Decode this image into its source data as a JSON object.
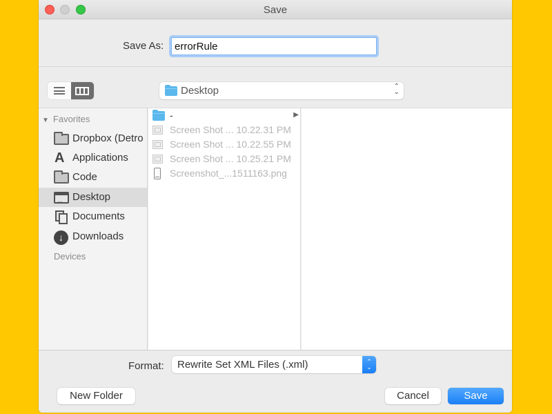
{
  "window": {
    "title": "Save",
    "background_color": "#FFC800"
  },
  "save_as": {
    "label": "Save As:",
    "value": "errorRule"
  },
  "toolbar": {
    "view_modes": [
      {
        "name": "list-view",
        "icon": "list-icon",
        "active": false
      },
      {
        "name": "column-view",
        "icon": "columns-icon",
        "active": true
      }
    ],
    "location": {
      "label": "Desktop",
      "icon": "folder-icon"
    }
  },
  "sidebar": {
    "sections": [
      {
        "header": "Favorites",
        "expanded": true,
        "items": [
          {
            "label": "Dropbox (Detroit)",
            "display": "Dropbox (Detro",
            "icon": "folder-icon",
            "selected": false
          },
          {
            "label": "Applications",
            "icon": "applications-icon",
            "selected": false
          },
          {
            "label": "Code",
            "icon": "folder-icon",
            "selected": false
          },
          {
            "label": "Desktop",
            "icon": "desktop-icon",
            "selected": true
          },
          {
            "label": "Documents",
            "icon": "documents-icon",
            "selected": false
          },
          {
            "label": "Downloads",
            "icon": "downloads-icon",
            "selected": false
          }
        ]
      },
      {
        "header": "Devices",
        "items": []
      }
    ]
  },
  "files": [
    {
      "name": "-",
      "type": "folder",
      "enabled": true,
      "has_children": true
    },
    {
      "name": "Screen Shot ... 10.22.31 PM",
      "type": "screenshot",
      "enabled": false
    },
    {
      "name": "Screen Shot ... 10.22.55 PM",
      "type": "screenshot",
      "enabled": false
    },
    {
      "name": "Screen Shot ... 10.25.21 PM",
      "type": "screenshot",
      "enabled": false
    },
    {
      "name": "Screenshot_...1511163.png",
      "type": "phone-image",
      "enabled": false
    }
  ],
  "format": {
    "label": "Format:",
    "value": "Rewrite Set XML Files (.xml)"
  },
  "buttons": {
    "new_folder": "New Folder",
    "cancel": "Cancel",
    "save": "Save"
  },
  "colors": {
    "accent": "#1B80F6",
    "close": "#FC5F57",
    "maximize": "#35C748"
  }
}
